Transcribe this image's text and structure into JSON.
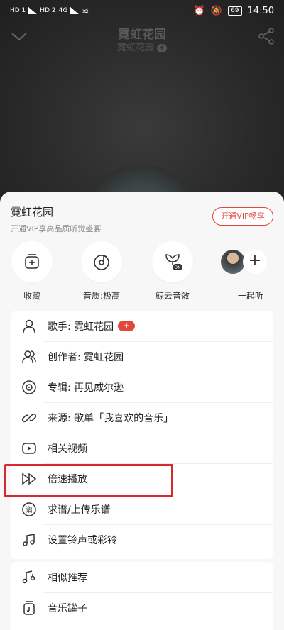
{
  "status_bar": {
    "time": "14:50",
    "battery": "69",
    "sim1": "HD 1",
    "sim2": "HD 2",
    "net": "4G"
  },
  "player": {
    "title": "霓虹花园",
    "artist": "霓虹花园"
  },
  "sheet": {
    "song_name": "霓虹花园",
    "subtitle": "开通VIP享高品质听觉盛宴",
    "vip_button": "开通VIP畅享",
    "actions": [
      {
        "label": "收藏",
        "icon": "collect-icon"
      },
      {
        "label": "音质:极高",
        "icon": "sound-quality-icon"
      },
      {
        "label": "鲸云音效",
        "icon": "whale-cloud-effect-icon"
      },
      {
        "label": "一起听",
        "icon": "listen-together-icon"
      }
    ],
    "menu": [
      {
        "label": "歌手: 霓虹花园",
        "icon": "singer-icon",
        "badge": "+"
      },
      {
        "label": "创作者: 霓虹花园",
        "icon": "creator-icon"
      },
      {
        "label": "专辑: 再见威尔逊",
        "icon": "album-icon"
      },
      {
        "label": "来源: 歌单「我喜欢的音乐」",
        "icon": "source-link-icon"
      },
      {
        "label": "相关视频",
        "icon": "video-icon"
      },
      {
        "label": "倍速播放",
        "icon": "speed-play-icon"
      },
      {
        "label": "求谱/上传乐谱",
        "icon": "sheet-music-icon"
      },
      {
        "label": "设置铃声或彩铃",
        "icon": "ringtone-icon"
      }
    ],
    "menu2": [
      {
        "label": "相似推荐",
        "icon": "similar-icon"
      },
      {
        "label": "音乐罐子",
        "icon": "music-jar-icon"
      }
    ]
  },
  "colors": {
    "accent": "#e2473f",
    "highlight": "#d7282f"
  }
}
